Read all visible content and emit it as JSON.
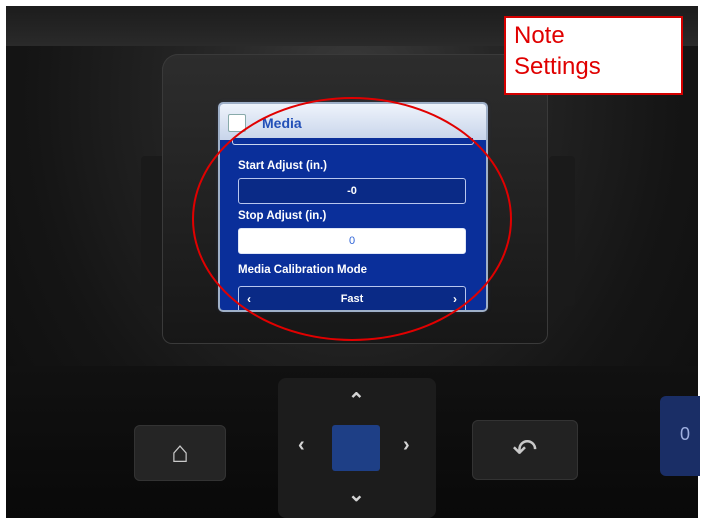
{
  "note": {
    "line1": "Note",
    "line2": "Settings"
  },
  "screen": {
    "title": "Media",
    "start_adjust": {
      "label": "Start Adjust (in.)",
      "value": "-0"
    },
    "stop_adjust": {
      "label": "Stop Adjust (in.)",
      "value": "0"
    },
    "calibration": {
      "label": "Media Calibration Mode",
      "value": "Fast",
      "left_arrow": "‹",
      "right_arrow": "›"
    }
  },
  "buttons": {
    "home": "⌂",
    "back": "↶",
    "up": "⌃",
    "down": "⌄",
    "left": "‹",
    "right": "›",
    "edge": "0"
  },
  "colors": {
    "screen_blue": "#0a2f9a",
    "highlight_red": "#e10000",
    "dpad_center": "#1e3f86"
  }
}
